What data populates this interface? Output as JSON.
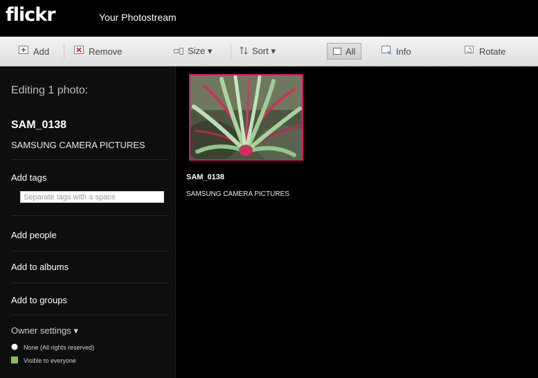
{
  "app": {
    "logo": "flickr",
    "page_title": "Your Photostream"
  },
  "toolbar": {
    "add": "Add",
    "remove": "Remove",
    "size": "Size ▾",
    "sort": "Sort ▾",
    "all": "All",
    "info": "Info",
    "rotate": "Rotate"
  },
  "sidebar": {
    "editing": "Editing 1 photo:",
    "photo_title": "SAM_0138",
    "photo_description": "SAMSUNG CAMERA PICTURES",
    "add_tags": "Add tags",
    "tags_placeholder": "Separate tags with a space",
    "add_people": "Add people",
    "add_to_albums": "Add to albums",
    "add_to_groups": "Add to groups",
    "owner_settings": "Owner settings ▾",
    "license": "None (All rights reserved)",
    "visibility": "Visible to everyone"
  },
  "photo": {
    "title": "SAM_0138",
    "description": "SAMSUNG CAMERA PICTURES"
  },
  "colors": {
    "selection_border": "#d81b60",
    "accent_green": "#8bc34a"
  }
}
